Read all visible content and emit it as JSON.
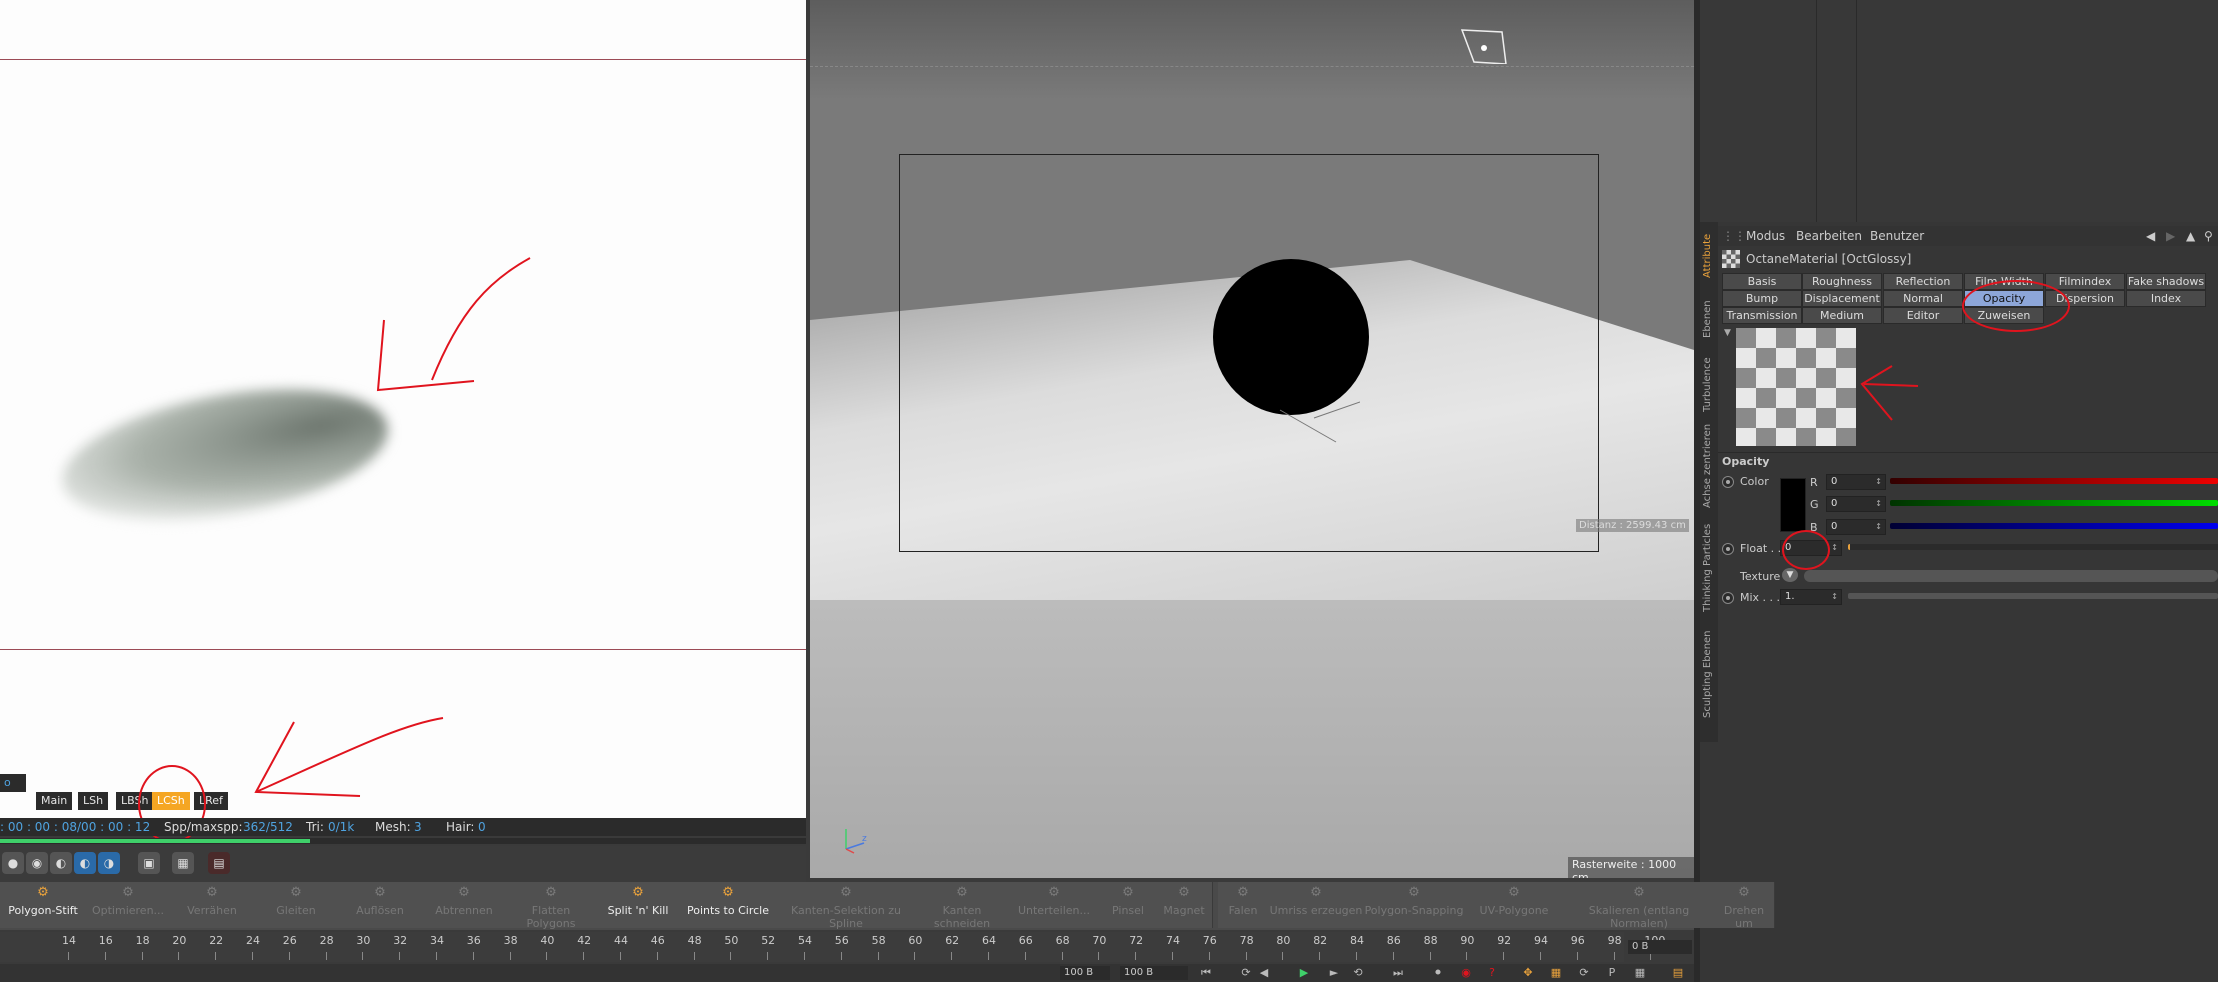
{
  "render_view": {
    "tabs": [
      "Main",
      "LSh",
      "LBSh",
      "LCSh",
      "LRef"
    ],
    "active_tab": "LCSh",
    "left_tab_stub": "o",
    "status": {
      "time": ": 00 : 00 : 08/00 : 00 : 12",
      "spp_label": "Spp/maxspp:",
      "spp_value": "362/512",
      "tri_label": "Tri:",
      "tri_value": "0/1k",
      "mesh_label": "Mesh:",
      "mesh_value": "3",
      "hair_label": "Hair:",
      "hair_value": "0"
    },
    "progress": 0.62,
    "accent_color": "#f5a623"
  },
  "viewport": {
    "distance": "Distanz : 2599.43 cm",
    "grid_width": "Rasterweite : 1000 cm",
    "axis_label": "z"
  },
  "attributes": {
    "side_tabs": [
      "Attribute",
      "Ebenen",
      "Turbulence",
      "Achse zentrieren",
      "Thinking Particles",
      "Sculpting Ebenen"
    ],
    "menu": [
      "Modus",
      "Bearbeiten",
      "Benutzer"
    ],
    "material_title": "OctaneMaterial [OctGlossy]",
    "tabs_row1": [
      "Basis",
      "Roughness",
      "Reflection",
      "Film Width",
      "Filmindex",
      "Fake shadows"
    ],
    "tabs_row2": [
      "Bump",
      "Displacement",
      "Normal",
      "Opacity",
      "Dispersion",
      "Index"
    ],
    "tabs_row3": [
      "Transmission",
      "Medium",
      "Editor",
      "Zuweisen"
    ],
    "active_tab": "Opacity",
    "section_title": "Opacity",
    "color_label": "Color",
    "r_label": "R",
    "g_label": "G",
    "b_label": "B",
    "r_value": "0",
    "g_value": "0",
    "b_value": "0",
    "float_label": "Float . .",
    "float_value": "0",
    "texture_label": "Texture",
    "mix_label": "Mix . . .",
    "mix_value": "1."
  },
  "tools": {
    "items": [
      {
        "label": "Polygon-Stift",
        "icon": "pen-icon",
        "enabled": true
      },
      {
        "label": "Optimieren...",
        "icon": "optimize-icon",
        "enabled": false
      },
      {
        "label": "Verrähen",
        "icon": "stitch-icon",
        "enabled": false
      },
      {
        "label": "Gleiten",
        "icon": "slide-icon",
        "enabled": false
      },
      {
        "label": "Auflösen",
        "icon": "dissolve-icon",
        "enabled": false
      },
      {
        "label": "Abtrennen",
        "icon": "split-icon",
        "enabled": false
      },
      {
        "label": "Flatten Polygons",
        "icon": "flatten-icon",
        "enabled": false
      },
      {
        "label": "Split 'n' Kill",
        "icon": "split-kill-icon",
        "enabled": true
      },
      {
        "label": "Points to Circle",
        "icon": "circle-icon",
        "enabled": true
      },
      {
        "label": "Kanten-Selektion zu Spline",
        "icon": "spline-icon",
        "enabled": false
      },
      {
        "label": "Kanten schneiden",
        "icon": "cut-icon",
        "enabled": false
      },
      {
        "label": "Unterteilen...",
        "icon": "subdivide-icon",
        "enabled": false
      },
      {
        "label": "Pinsel",
        "icon": "brush-icon",
        "enabled": false
      },
      {
        "label": "Magnet",
        "icon": "magnet-icon",
        "enabled": false
      },
      {
        "label": "Falen",
        "icon": "fold-icon",
        "enabled": false
      },
      {
        "label": "Umriss erzeugen",
        "icon": "outline-icon",
        "enabled": false
      },
      {
        "label": "Polygon-Snapping",
        "icon": "snap-icon",
        "enabled": false
      },
      {
        "label": "UV-Polygone",
        "icon": "uv-icon",
        "enabled": false
      },
      {
        "label": "Skalieren (entlang Normalen)",
        "icon": "scale-icon",
        "enabled": false
      },
      {
        "label": "Drehen um",
        "icon": "rotate-icon",
        "enabled": false
      }
    ]
  },
  "timeline": {
    "ticks": [
      "14",
      "16",
      "18",
      "20",
      "22",
      "24",
      "26",
      "28",
      "30",
      "32",
      "34",
      "36",
      "38",
      "40",
      "42",
      "44",
      "46",
      "48",
      "50",
      "52",
      "54",
      "56",
      "58",
      "60",
      "62",
      "64",
      "66",
      "68",
      "70",
      "72",
      "74",
      "76",
      "78",
      "80",
      "82",
      "84",
      "86",
      "88",
      "90",
      "92",
      "94",
      "96",
      "98",
      "100"
    ],
    "frame_field": "0 B",
    "start_field": "100 B",
    "end_field": "100 B"
  }
}
